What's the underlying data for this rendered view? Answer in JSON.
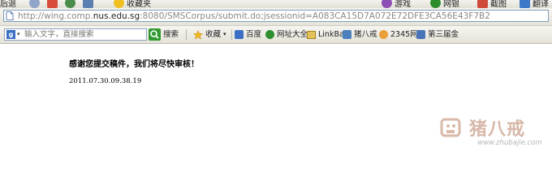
{
  "top_toolbar": {
    "items": [
      "后退",
      "收藏夹",
      "游戏",
      "网银",
      "截图",
      "翻译"
    ]
  },
  "address_bar": {
    "url_prefix": "http://wing.comp.",
    "url_host": "nus.edu.sg",
    "url_rest": ":8080/SMSCorpus/submit.do;jsessionid=A083CA15D7A072E72DFE3CA56E43F7B2"
  },
  "links_bar": {
    "search_placeholder": "输入文字，直接搜索",
    "search_label": "搜索",
    "favorites_label": "收藏",
    "links": [
      "百度",
      "网址大全",
      "LinkBar",
      "猪八戒",
      "2345网",
      "第三届金"
    ]
  },
  "page": {
    "thanks_message": "感谢您提交稿件，我们将尽快审核！",
    "timestamp": "2011.07.30.09.38.19"
  },
  "watermark": {
    "text": "猪八戒",
    "url": "www.zhubajie.com"
  }
}
